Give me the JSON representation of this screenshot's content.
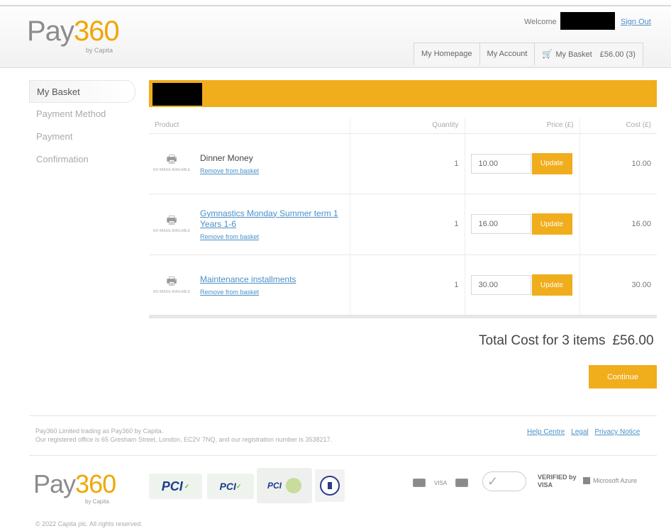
{
  "header": {
    "logo_pay": "Pay",
    "logo_num": "360",
    "logo_sub": "by Capita",
    "welcome": "Welcome",
    "sign_out": "Sign Out",
    "nav": {
      "homepage": "My Homepage",
      "account": "My Account",
      "basket": "My Basket",
      "basket_total": "£56.00 (3)"
    }
  },
  "sidebar": {
    "items": [
      {
        "label": "My Basket",
        "active": true
      },
      {
        "label": "Payment Method",
        "active": false
      },
      {
        "label": "Payment",
        "active": false
      },
      {
        "label": "Confirmation",
        "active": false
      }
    ]
  },
  "basket": {
    "columns": {
      "product": "Product",
      "quantity": "Quantity",
      "price": "Price (£)",
      "cost": "Cost (£)"
    },
    "no_image_caption": "NO IMAGE AVAILABLE",
    "remove_label": "Remove from basket",
    "update_label": "Update",
    "rows": [
      {
        "name": "Dinner Money",
        "is_link": false,
        "quantity": "1",
        "price": "10.00",
        "cost": "10.00"
      },
      {
        "name": "Gymnastics Monday Summer term 1 Years 1-6",
        "is_link": true,
        "quantity": "1",
        "price": "16.00",
        "cost": "16.00"
      },
      {
        "name": "Maintenance installments",
        "is_link": true,
        "quantity": "1",
        "price": "30.00",
        "cost": "30.00"
      }
    ]
  },
  "summary": {
    "total_label": "Total Cost for 3 items",
    "total_amount": "£56.00",
    "continue_label": "Continue"
  },
  "footer": {
    "legal_line1": "Pay360 Limited trading as Pay360 by Capita.",
    "legal_line2": "Our registered office is 65 Gresham Street, London, EC2V 7NQ, and our registration number is 3538217.",
    "links": [
      "Help Centre",
      "Legal",
      "Privacy Notice"
    ],
    "logo_pay": "Pay",
    "logo_num": "360",
    "logo_sub": "by Capita",
    "visa_label": "VISA",
    "verified_label": "VERIFIED by VISA",
    "azure_label": "Microsoft Azure",
    "copyright": "© 2022 Capita plc. All rights reserved."
  },
  "colors": {
    "accent": "#f0ad1c",
    "link": "#4a90c8",
    "logo_orange": "#f0a700",
    "logo_grey": "#8c8c8c"
  }
}
